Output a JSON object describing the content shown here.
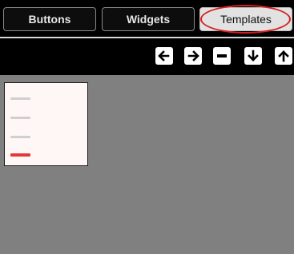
{
  "tabs": [
    {
      "label": "Buttons"
    },
    {
      "label": "Widgets"
    },
    {
      "label": "Templates",
      "selected": true
    }
  ],
  "toolbar": {
    "buttons": [
      {
        "icon": "arrow-left-icon"
      },
      {
        "icon": "arrow-right-icon"
      },
      {
        "icon": "minus-icon"
      },
      {
        "icon": "arrow-down-icon"
      },
      {
        "icon": "arrow-up-icon"
      }
    ]
  },
  "template_thumbnail": {
    "line_colors": [
      "#cfcfcf",
      "#cfcfcf",
      "#cfcfcf",
      "#e23a3a"
    ]
  },
  "colors": {
    "bar_background": "#000000",
    "canvas_background": "#808080",
    "highlight": "#d61f1f",
    "active_tab": "#e2e2e2"
  }
}
